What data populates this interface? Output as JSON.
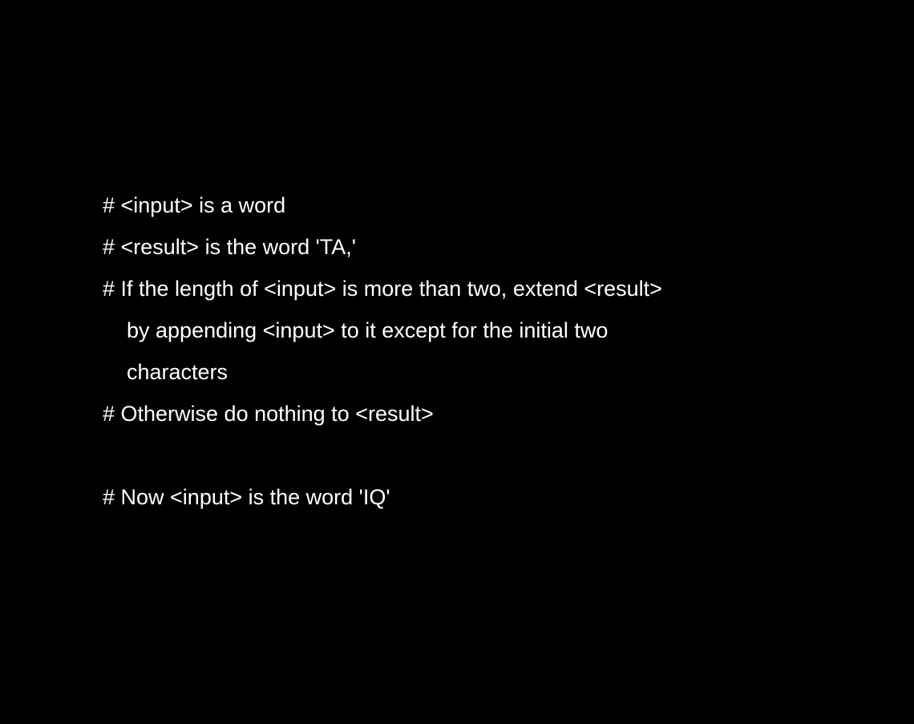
{
  "lines": [
    {
      "text": "# <input> is a word"
    },
    {
      "text": "# <result> is the word 'TA,'"
    },
    {
      "text": "# If the length of <input> is more than two, extend <result>"
    },
    {
      "text": "by appending <input> to it except for the initial two"
    },
    {
      "text": "characters"
    },
    {
      "text": "# Otherwise do nothing to <result>"
    },
    {
      "text": ""
    },
    {
      "text": "# Now <input> is the word 'IQ'"
    }
  ],
  "colors": {
    "background": "#000000",
    "text": "#ffffff"
  }
}
